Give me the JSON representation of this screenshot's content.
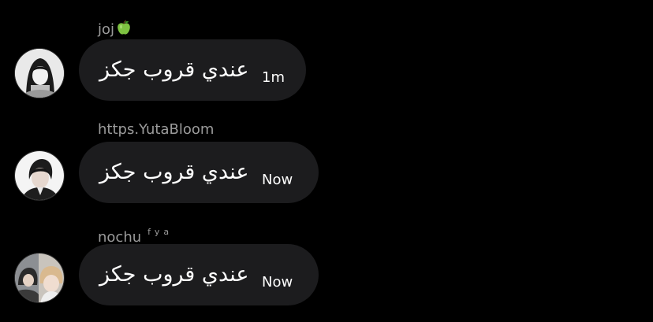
{
  "colors": {
    "background": "#000000",
    "bubble": "#1c1c1e",
    "sender_text": "#9b9b9b",
    "message_text": "#ffffff"
  },
  "messages": [
    {
      "sender": "joj",
      "sender_icon": "green-apple-icon",
      "flair": "",
      "text": "عندي قروب جكز",
      "time": "1m",
      "avatar": "avatar-icon"
    },
    {
      "sender": "https.YutaBloom",
      "sender_icon": "",
      "flair": "",
      "text": "عندي قروب جكز",
      "time": "Now",
      "avatar": "avatar-icon"
    },
    {
      "sender": "nochu",
      "sender_icon": "",
      "flair": "fya",
      "text": "عندي قروب جكز",
      "time": "Now",
      "avatar": "avatar-icon"
    }
  ]
}
